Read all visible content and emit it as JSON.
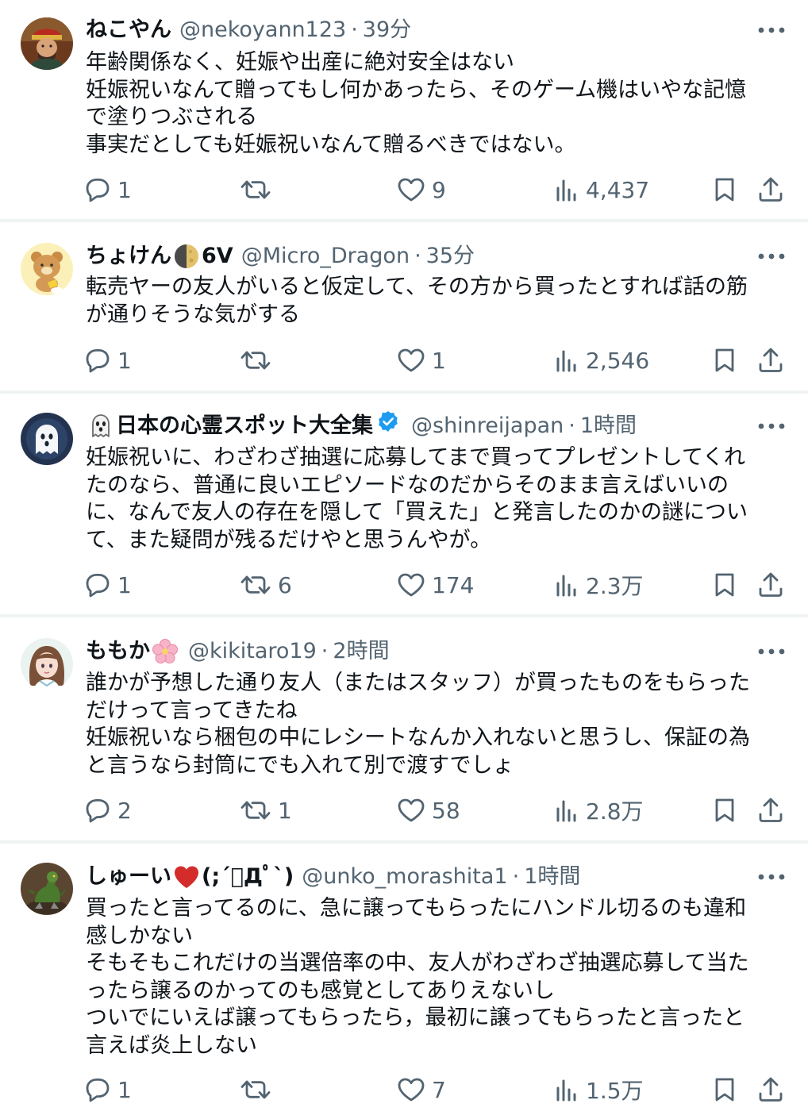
{
  "tweets": [
    {
      "name": "ねこやん",
      "handle": "@nekoyann123",
      "time": "39分",
      "lines": [
        "年齢関係なく、妊娠や出産に絶対安全はない",
        "妊娠祝いなんて贈ってもし何かあったら、そのゲーム機はいやな記憶",
        "で塗りつぶされる",
        "事実だとしても妊娠祝いなんて贈るべきではない。"
      ],
      "replies": "1",
      "retweets": "",
      "likes": "9",
      "views": "4,437"
    },
    {
      "name": "ちょけん",
      "name_suffix": "6V",
      "handle": "@Micro_Dragon",
      "time": "35分",
      "lines": [
        "転売ヤーの友人がいると仮定して、その方から買ったとすれば話の筋",
        "が通りそうな気がする"
      ],
      "replies": "1",
      "retweets": "",
      "likes": "1",
      "views": "2,546"
    },
    {
      "name": "日本の心霊スポット大全集",
      "handle": "@shinreijapan",
      "time": "1時間",
      "lines": [
        "妊娠祝いに、わざわざ抽選に応募してまで買ってプレゼントしてくれ",
        "たのなら、普通に良いエピソードなのだからそのまま言えばいいの",
        "に、なんで友人の存在を隠して「買えた」と発言したのかの謎につい",
        "て、また疑問が残るだけやと思うんやが。"
      ],
      "replies": "1",
      "retweets": "6",
      "likes": "174",
      "views": "2.3万"
    },
    {
      "name": "ももか",
      "handle": "@kikitaro19",
      "time": "2時間",
      "lines": [
        "誰かが予想した通り友人（またはスタッフ）が買ったものをもらった",
        "だけって言ってきたね",
        "妊娠祝いなら梱包の中にレシートなんか入れないと思うし、保証の為",
        "と言うなら封筒にでも入れて別で渡すでしょ"
      ],
      "replies": "2",
      "retweets": "1",
      "likes": "58",
      "views": "2.8万"
    },
    {
      "name": "しゅーい",
      "name_suffix": "(;´ﾟДﾟ`)",
      "handle": "@unko_morashita1",
      "time": "1時間",
      "lines": [
        "買ったと言ってるのに、急に譲ってもらったにハンドル切るのも違和",
        "感しかない",
        "そもそもこれだけの当選倍率の中、友人がわざわざ抽選応募して当た",
        "ったら譲るのかってのも感覚としてありえないし",
        "ついでにいえば譲ってもらったら，最初に譲ってもらったと言ったと",
        "言えば炎上しない"
      ],
      "replies": "1",
      "retweets": "",
      "likes": "7",
      "views": "1.5万"
    }
  ],
  "separator": "·",
  "colors": {
    "text": "#0f1419",
    "secondary": "#536471",
    "verified": "#1d9bf0",
    "divider": "#eff3f4",
    "heart_emoji": "#d42b2b"
  },
  "icons": [
    "more-icon",
    "reply-icon",
    "retweet-icon",
    "like-icon",
    "views-icon",
    "bookmark-icon",
    "share-icon",
    "verified-badge-icon",
    "moon-emoji-icon",
    "ghost-emoji-icon",
    "blossom-emoji-icon",
    "heart-emoji-icon"
  ]
}
